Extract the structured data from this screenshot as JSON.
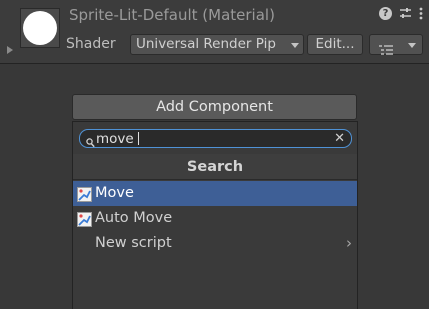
{
  "material": {
    "title": "Sprite-Lit-Default (Material)",
    "shader_label": "Shader",
    "shader_value": "Universal Render Pip",
    "edit_label": "Edit...",
    "icons": [
      "help-icon",
      "preset-icon",
      "kebab-icon",
      "list-icon"
    ]
  },
  "add_component": {
    "label": "Add Component"
  },
  "popup": {
    "search_value": "move",
    "title": "Search",
    "results": [
      {
        "label": "Move",
        "icon": "script-icon",
        "selected": true
      },
      {
        "label": "Auto Move",
        "icon": "script-icon",
        "selected": false
      },
      {
        "label": "New script",
        "icon": "",
        "selected": false,
        "has_submenu": true
      }
    ]
  },
  "colors": {
    "background": "#383838",
    "selection": "#3e5f96",
    "focus_border": "#4f92d6"
  }
}
